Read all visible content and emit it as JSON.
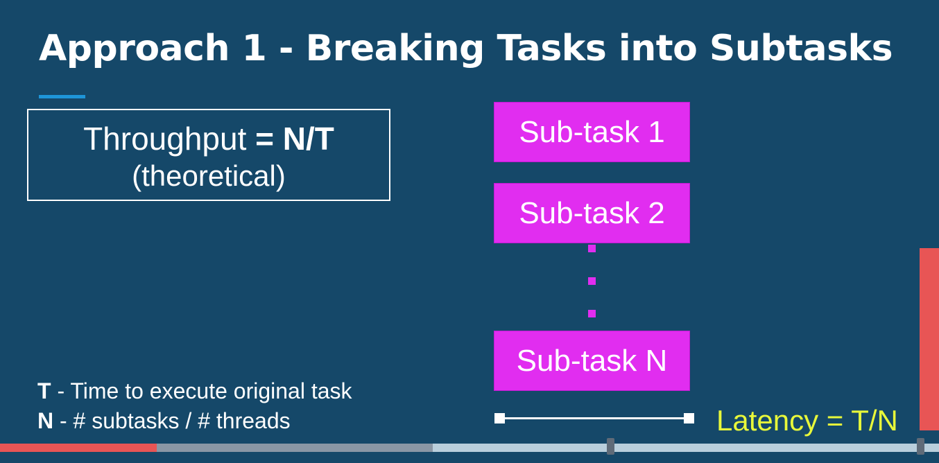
{
  "slide": {
    "title": "Approach 1 - Breaking Tasks into Subtasks",
    "formula": {
      "label": "Throughput",
      "equals": " = ",
      "value": "N/T",
      "note": "(theoretical)"
    },
    "subtasks": [
      "Sub-task 1",
      "Sub-task 2",
      "Sub-task N"
    ],
    "legend": [
      {
        "symbol": "T",
        "text": " - Time to execute original task"
      },
      {
        "symbol": "N",
        "text": " - # subtasks / # threads"
      }
    ],
    "latency_label": "Latency = T/N"
  },
  "colors": {
    "background": "#154869",
    "subtask_fill": "#e12df0",
    "latency_text": "#e8f83a",
    "accent_blue": "#1e95d8",
    "accent_red": "#e85555"
  },
  "player": {
    "progress_fraction": 0.167,
    "buffered_fraction": 0.461,
    "chapter_marker_fractions": [
      0.65,
      0.98
    ]
  }
}
